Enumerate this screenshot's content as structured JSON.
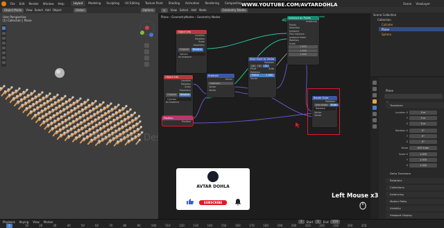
{
  "menu": [
    "File",
    "Edit",
    "Render",
    "Window",
    "Help"
  ],
  "workspaces": [
    "Layout",
    "Modeling",
    "Sculpting",
    "UV Editing",
    "Texture Paint",
    "Shading",
    "Animation",
    "Rendering",
    "Compositing",
    "Geometry Nodes",
    "Scripting"
  ],
  "active_workspace": "Layout",
  "scene": {
    "name": "Scene",
    "view_layer": "ViewLayer"
  },
  "viewport": {
    "mode": "Object Mode",
    "view": "View",
    "select": "Select",
    "add": "Add",
    "object": "Object",
    "orientation": "Global",
    "options": "Options",
    "overlay_line1": "User Perspective",
    "overlay_line2": "(1) Collection | Plane",
    "watermark": "Geometric Design"
  },
  "node_editor": {
    "menus": [
      "View",
      "Select",
      "Add",
      "Node"
    ],
    "modifier": "GeometryNodes",
    "tree": "Geometry Nodes",
    "breadcrumb_obj": "Plane",
    "breadcrumb_mod": "GeometryNodes",
    "breadcrumb_tree": "Geometry Nodes"
  },
  "url_banner": "WWW.YOUTUBE.COM/AVTARDOHLA",
  "nodes": {
    "object_info_top": {
      "title": "Object Info",
      "rows": [
        "Location",
        "Rotation",
        "Scale",
        "Geometry"
      ],
      "opts": [
        "Original",
        "Relative"
      ],
      "obj": "Sphere",
      "toggle": "As Instance"
    },
    "object_info_mid": {
      "title": "Object Info",
      "rows": [
        "Location",
        "Rotation",
        "Scale",
        "Geometry"
      ],
      "opts": [
        "Original",
        "Relative"
      ],
      "obj": "Cylinder",
      "toggle": "As Instance"
    },
    "instance_on_points": {
      "title": "Instance on Points",
      "rows": [
        "Instances",
        "Points",
        "Selection",
        "Instance",
        "Pick Instance",
        "Instance Index",
        "Rotation",
        "Scale"
      ],
      "scale_values": [
        "1.000",
        "1.000",
        "1.000"
      ]
    },
    "subtract": {
      "title": "Subtract",
      "rows": [
        "Vector",
        "Subtract",
        "Vector",
        "Vector"
      ]
    },
    "align_euler": {
      "title": "Align Euler to Vector",
      "rows": [
        "Rotation",
        "Rotation",
        "Factor",
        "Vector"
      ],
      "axis": [
        "X",
        "Y",
        "Z"
      ],
      "pivot_label": "Pivot",
      "pivot": "Auto",
      "factor_value": "1.000"
    },
    "position": {
      "title": "Position",
      "rows": [
        "Position"
      ]
    },
    "rotate_euler": {
      "title": "Rotate Euler",
      "rows": [
        "Rotation",
        "Rotation",
        "Vector",
        "Vector"
      ],
      "mode": [
        "Axis Angle",
        "Euler"
      ]
    }
  },
  "outliner": {
    "title": "Scene Collection",
    "items": [
      "Collection",
      "Cylinder",
      "Plane",
      "Sphere"
    ]
  },
  "properties": {
    "object": "Plane",
    "sections": [
      "Transform",
      "Delta Transform",
      "Relations",
      "Collections",
      "Instancing",
      "Motion Paths",
      "Visibility",
      "Viewport Display",
      "Line Art",
      "Custom Properties"
    ],
    "location": {
      "label": "Location X",
      "y": "Y",
      "z": "Z",
      "values": [
        "0 m",
        "0 m",
        "0 m"
      ]
    },
    "rotation": {
      "label": "Rotation X",
      "y": "Y",
      "z": "Z",
      "values": [
        "0°",
        "0°",
        "0°"
      ]
    },
    "mode": {
      "label": "Mode",
      "value": "XYZ Euler"
    },
    "scale": {
      "label": "Scale X",
      "y": "Y",
      "z": "Z",
      "values": [
        "1.000",
        "1.000",
        "1.000"
      ]
    }
  },
  "card": {
    "name": "AVTAR DOHLA",
    "subscribe": "SUBSCRIBE",
    "colors": {
      "subscribe": "#e0192a",
      "like": "#3b5fd0"
    }
  },
  "mouse_hint": "Left Mouse x3",
  "timeline": {
    "menus": [
      "Playback",
      "Keying",
      "View",
      "Marker"
    ],
    "frames": [
      "10",
      "20",
      "30",
      "40",
      "50",
      "60",
      "70",
      "80",
      "90",
      "100",
      "110",
      "120",
      "130",
      "140",
      "150",
      "160",
      "170",
      "180",
      "190",
      "200",
      "210",
      "220",
      "230",
      "240",
      "250"
    ],
    "current_frame": "1",
    "start_label": "Start",
    "start": "1",
    "end_label": "End",
    "end": "250"
  },
  "colors": {
    "accent": "#e87d0d",
    "highlight_box": "#e0192a",
    "geo_socket": "#00d6a3",
    "vec_socket": "#6363c7",
    "float_socket": "#a1a1a1",
    "link_purple": "#6b5bd0",
    "link_green": "#24c89a"
  }
}
